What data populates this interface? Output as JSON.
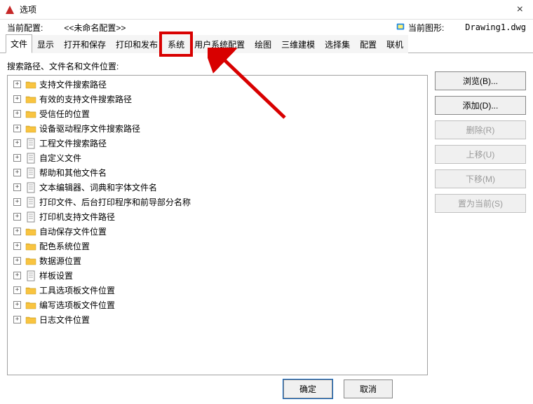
{
  "window": {
    "title": "选项",
    "close_glyph": "×"
  },
  "info": {
    "profile_label": "当前配置:",
    "profile_value": "<<未命名配置>>",
    "drawing_label": "当前图形:",
    "drawing_name": "Drawing1.dwg"
  },
  "tabs": [
    {
      "label": "文件",
      "active": true,
      "highlight": false
    },
    {
      "label": "显示",
      "active": false,
      "highlight": false
    },
    {
      "label": "打开和保存",
      "active": false,
      "highlight": false
    },
    {
      "label": "打印和发布",
      "active": false,
      "highlight": false
    },
    {
      "label": "系统",
      "active": false,
      "highlight": true
    },
    {
      "label": "用户系统配置",
      "active": false,
      "highlight": false
    },
    {
      "label": "绘图",
      "active": false,
      "highlight": false
    },
    {
      "label": "三维建模",
      "active": false,
      "highlight": false
    },
    {
      "label": "选择集",
      "active": false,
      "highlight": false
    },
    {
      "label": "配置",
      "active": false,
      "highlight": false
    },
    {
      "label": "联机",
      "active": false,
      "highlight": false
    }
  ],
  "section_label": "搜索路径、文件名和文件位置:",
  "tree": [
    {
      "label": "支持文件搜索路径",
      "icon": "folder"
    },
    {
      "label": "有效的支持文件搜索路径",
      "icon": "folder"
    },
    {
      "label": "受信任的位置",
      "icon": "folder"
    },
    {
      "label": "设备驱动程序文件搜索路径",
      "icon": "folder"
    },
    {
      "label": "工程文件搜索路径",
      "icon": "doc"
    },
    {
      "label": "自定义文件",
      "icon": "doc"
    },
    {
      "label": "帮助和其他文件名",
      "icon": "doc"
    },
    {
      "label": "文本编辑器、词典和字体文件名",
      "icon": "doc"
    },
    {
      "label": "打印文件、后台打印程序和前导部分名称",
      "icon": "doc"
    },
    {
      "label": "打印机支持文件路径",
      "icon": "doc"
    },
    {
      "label": "自动保存文件位置",
      "icon": "folder"
    },
    {
      "label": "配色系统位置",
      "icon": "folder"
    },
    {
      "label": "数据源位置",
      "icon": "folder"
    },
    {
      "label": "样板设置",
      "icon": "doc"
    },
    {
      "label": "工具选项板文件位置",
      "icon": "folder"
    },
    {
      "label": "编写选项板文件位置",
      "icon": "folder"
    },
    {
      "label": "日志文件位置",
      "icon": "folder"
    }
  ],
  "buttons": [
    {
      "label": "浏览(B)...",
      "enabled": true,
      "name": "browse-button"
    },
    {
      "label": "添加(D)...",
      "enabled": true,
      "name": "add-button"
    },
    {
      "label": "删除(R)",
      "enabled": false,
      "name": "delete-button"
    },
    {
      "label": "上移(U)",
      "enabled": false,
      "name": "moveup-button"
    },
    {
      "label": "下移(M)",
      "enabled": false,
      "name": "movedown-button"
    },
    {
      "label": "置为当前(S)",
      "enabled": false,
      "name": "setcurrent-button"
    }
  ],
  "footer": {
    "ok": "确定",
    "cancel": "取消"
  },
  "expander_glyph": "+"
}
